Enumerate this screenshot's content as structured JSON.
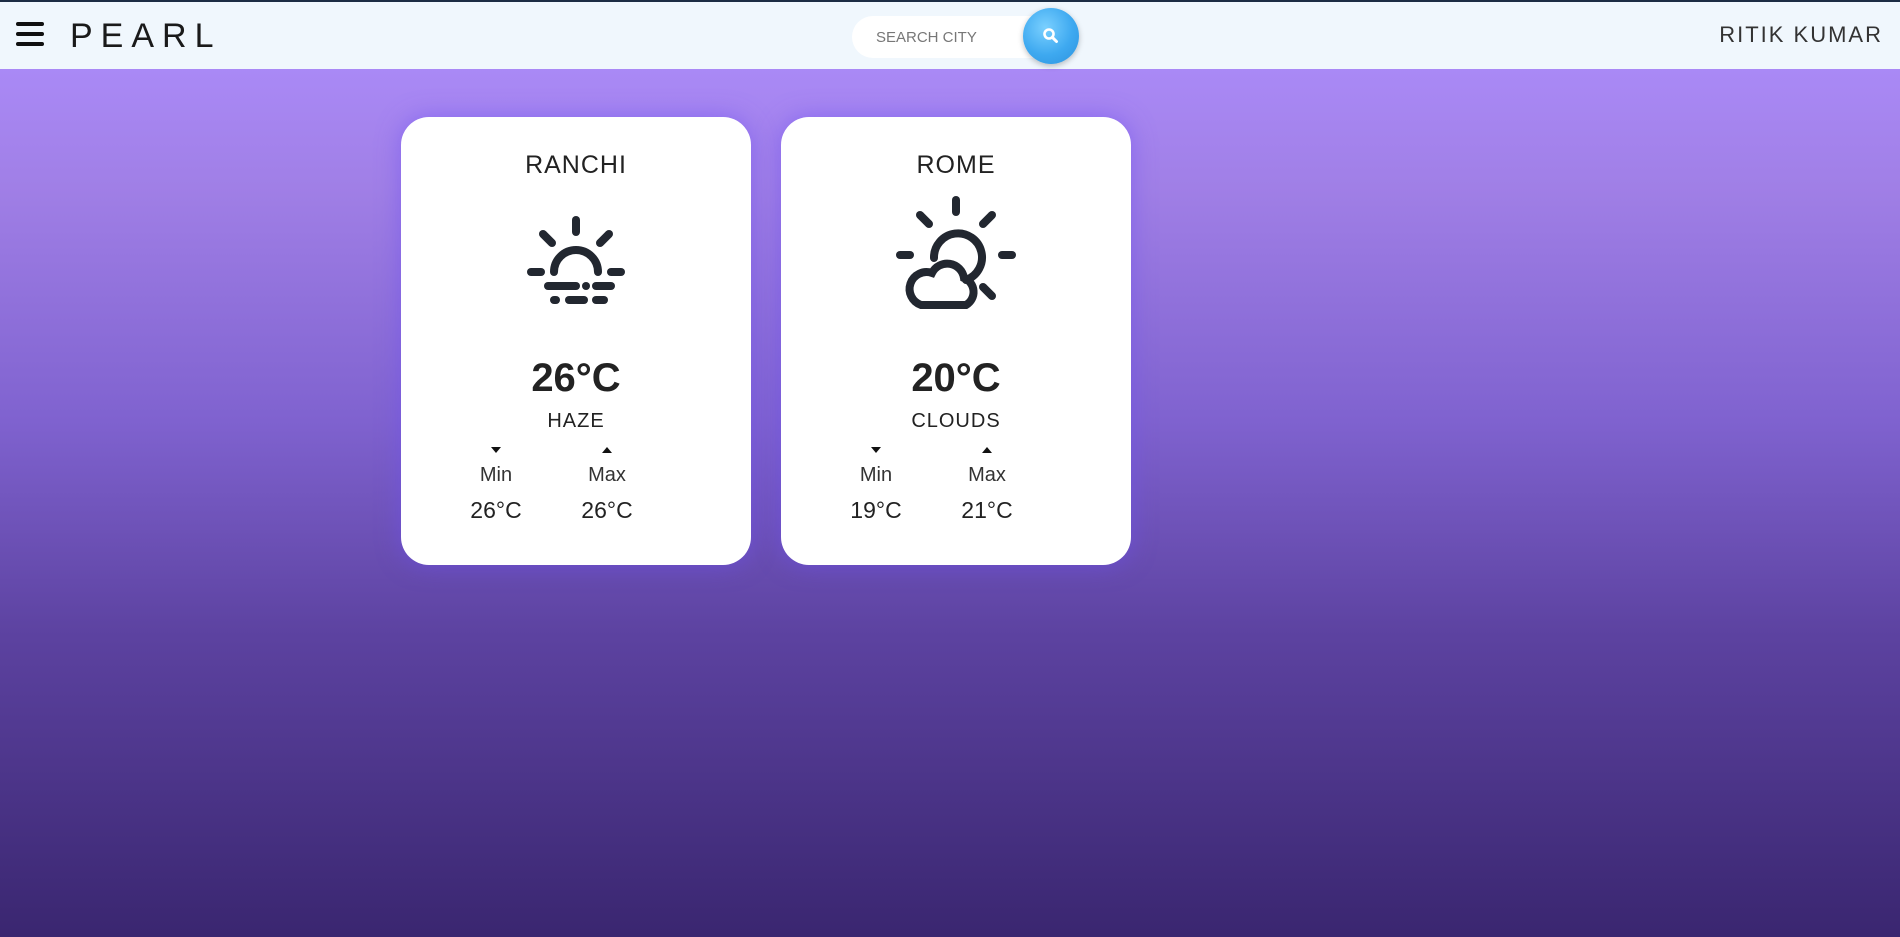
{
  "header": {
    "brand": "PEARL",
    "search_placeholder": "SEARCH CITY",
    "user_name": "RITIK KUMAR"
  },
  "cards": [
    {
      "city": "RANCHI",
      "icon": "haze-icon",
      "temperature": "26°C",
      "condition": "HAZE",
      "min_label": "Min",
      "min_value": "26°C",
      "max_label": "Max",
      "max_value": "26°C"
    },
    {
      "city": "ROME",
      "icon": "cloudy-sun-icon",
      "temperature": "20°C",
      "condition": "CLOUDS",
      "min_label": "Min",
      "min_value": "19°C",
      "max_label": "Max",
      "max_value": "21°C"
    }
  ],
  "colors": {
    "navbar_bg": "#f0f7fd",
    "search_button": "#3ea9f0",
    "gradient_top": "#af8fff",
    "gradient_bottom": "#3a2670",
    "card_bg": "#ffffff"
  }
}
